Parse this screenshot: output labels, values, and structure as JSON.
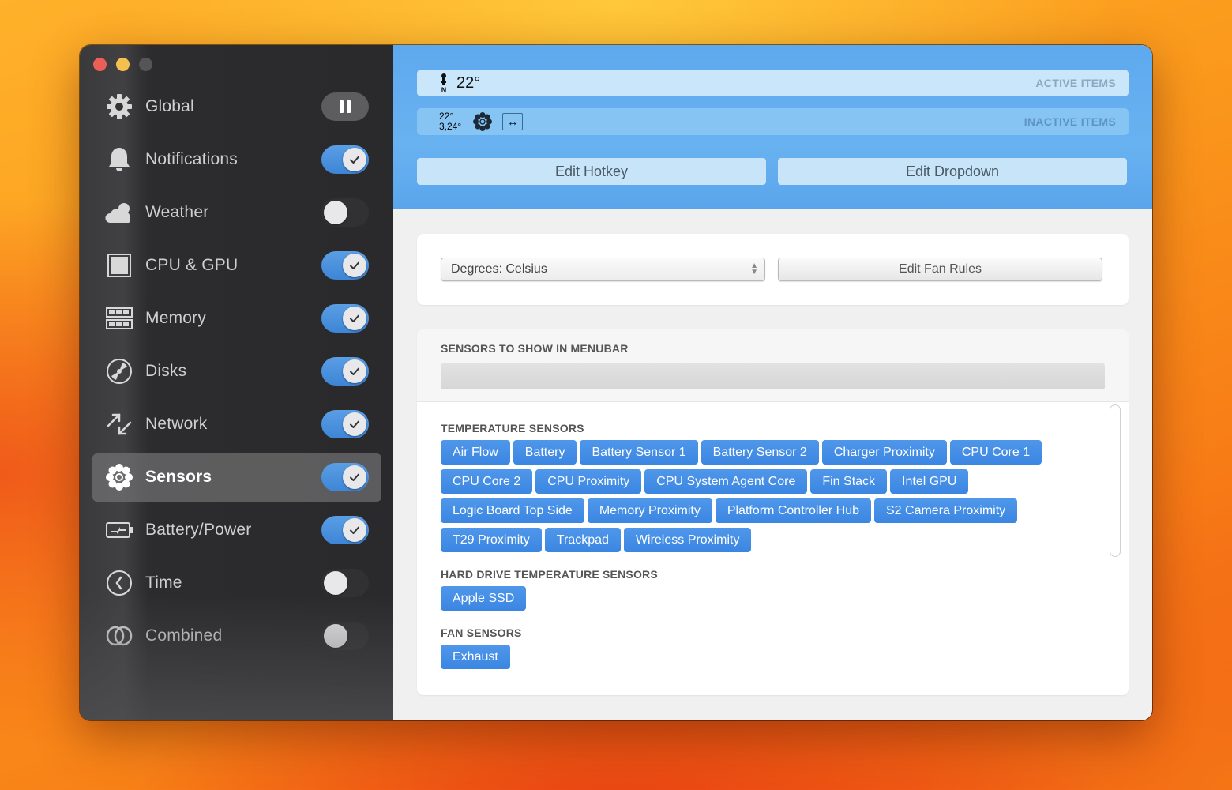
{
  "window": {
    "traffic_lights": [
      "close",
      "minimize",
      "maximize"
    ]
  },
  "sidebar": {
    "items": [
      {
        "label": "Global",
        "icon": "gear-icon",
        "control": "pause",
        "active": false
      },
      {
        "label": "Notifications",
        "icon": "bell-icon",
        "control": "toggle",
        "on": true,
        "active": false
      },
      {
        "label": "Weather",
        "icon": "cloud-icon",
        "control": "toggle",
        "on": false,
        "active": false
      },
      {
        "label": "CPU & GPU",
        "icon": "chip-icon",
        "control": "toggle",
        "on": true,
        "active": false
      },
      {
        "label": "Memory",
        "icon": "memory-icon",
        "control": "toggle",
        "on": true,
        "active": false
      },
      {
        "label": "Disks",
        "icon": "disk-icon",
        "control": "toggle",
        "on": true,
        "active": false
      },
      {
        "label": "Network",
        "icon": "network-arrows-icon",
        "control": "toggle",
        "on": true,
        "active": false
      },
      {
        "label": "Sensors",
        "icon": "fan-icon",
        "control": "toggle",
        "on": true,
        "active": true
      },
      {
        "label": "Battery/Power",
        "icon": "battery-icon",
        "control": "toggle",
        "on": true,
        "active": false
      },
      {
        "label": "Time",
        "icon": "clock-icon",
        "control": "toggle",
        "on": false,
        "active": false
      },
      {
        "label": "Combined",
        "icon": "rings-icon",
        "control": "toggle",
        "on": false,
        "active": false
      }
    ]
  },
  "header": {
    "active_items": {
      "label": "ACTIVE ITEMS",
      "temp": "22°"
    },
    "inactive_items": {
      "label": "INACTIVE ITEMS",
      "temp_line1": "22°",
      "temp_line2": "3,24°",
      "arrows": "↔"
    },
    "edit_hotkey": "Edit Hotkey",
    "edit_dropdown": "Edit Dropdown",
    "accent": "#5ea8ee"
  },
  "settings": {
    "degrees_select": "Degrees: Celsius",
    "edit_fan_rules": "Edit Fan Rules"
  },
  "sensors": {
    "menubar_title": "SENSORS TO SHOW IN MENUBAR",
    "groups": [
      {
        "title": "TEMPERATURE SENSORS",
        "items": [
          "Air Flow",
          "Battery",
          "Battery Sensor 1",
          "Battery Sensor 2",
          "Charger Proximity",
          "CPU Core 1",
          "CPU Core 2",
          "CPU Proximity",
          "CPU System Agent Core",
          "Fin Stack",
          "Intel GPU",
          "Logic Board Top Side",
          "Memory Proximity",
          "Platform Controller Hub",
          "S2 Camera Proximity",
          "T29 Proximity",
          "Trackpad",
          "Wireless Proximity"
        ]
      },
      {
        "title": "HARD DRIVE TEMPERATURE SENSORS",
        "items": [
          "Apple SSD"
        ]
      },
      {
        "title": "FAN SENSORS",
        "items": [
          "Exhaust"
        ]
      }
    ],
    "chip_color": "#3d88e3"
  }
}
